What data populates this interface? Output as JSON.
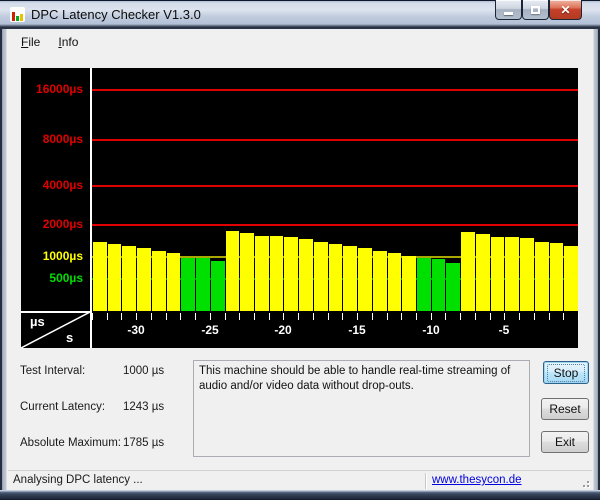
{
  "window": {
    "title": "DPC Latency Checker V1.3.0"
  },
  "titlebar_icons": {
    "app_icon": "bar-chart-icon",
    "minimize": "minimize-icon",
    "maximize": "maximize-icon",
    "close": "close-icon"
  },
  "menu": {
    "items": [
      {
        "label": "File"
      },
      {
        "label": "Info"
      }
    ]
  },
  "chart_data": {
    "type": "bar",
    "title": "DPC latency history (one bar per second, bar height = maximum latency in µs)",
    "ylabel": "µs",
    "xlabel": "s",
    "y_axis_unit_label": "µs",
    "x_axis_unit_label": "s",
    "scale_note": "pseudo-log scale: y_px = 77.9 * ln(1 + value/1000)",
    "ylim": [
      0,
      20000
    ],
    "grid": true,
    "gridlines": [
      {
        "value": 16000,
        "label": "16000µs",
        "label_color": "#e00000",
        "line_color": "#e00000"
      },
      {
        "value": 8000,
        "label": "8000µs",
        "label_color": "#e00000",
        "line_color": "#e00000"
      },
      {
        "value": 4000,
        "label": "4000µs",
        "label_color": "#e00000",
        "line_color": "#e00000"
      },
      {
        "value": 2000,
        "label": "2000µs",
        "label_color": "#e00000",
        "line_color": "#e00000"
      },
      {
        "value": 1000,
        "label": "1000µs",
        "label_color": "#ffff00",
        "line_color": "#a8a800"
      },
      {
        "value": 500,
        "label": "500µs",
        "label_color": "#00dd00",
        "line_color": "#00a000"
      }
    ],
    "x_tick_labels": [
      "-30",
      "-25",
      "-20",
      "-15",
      "-10",
      "-5"
    ],
    "x_tick_label_slots": [
      3,
      8,
      13,
      18,
      23,
      28
    ],
    "bar_count": 33,
    "values_us": [
      1434,
      1355,
      1313,
      1237,
      1160,
      1097,
      985,
      975,
      905,
      1785,
      1732,
      1630,
      1630,
      1597,
      1521,
      1416,
      1355,
      1313,
      1255,
      1160,
      1097,
      1032,
      982,
      957,
      862,
      1745,
      1685,
      1597,
      1597,
      1545,
      1434,
      1404,
      1313
    ],
    "bar_color_ok": "#00e000",
    "bar_color_warn": "#ffff00",
    "green_threshold_us": 1000,
    "plot_bg": "#000000"
  },
  "stats": {
    "rows": [
      {
        "label": "Test Interval:",
        "value": "1000 µs"
      },
      {
        "label": "Current Latency:",
        "value": "1243 µs"
      },
      {
        "label": "Absolute Maximum:",
        "value": "1785 µs"
      }
    ]
  },
  "info_panel": {
    "text": "This machine should be able to handle real-time streaming of audio and/or video data without drop-outs."
  },
  "buttons": [
    {
      "label": "Stop",
      "focused": true
    },
    {
      "label": "Reset",
      "focused": false
    },
    {
      "label": "Exit",
      "focused": false
    }
  ],
  "statusbar": {
    "left_text": "Analysing DPC latency ...",
    "link_text": "www.thesycon.de"
  },
  "colors": {
    "dialog_bg": "#f0f0f0",
    "chart_bg": "#000000",
    "red_grid": "#e00000",
    "yellow_bar": "#ffff00",
    "green_bar": "#00e000",
    "link_blue": "#0000e0",
    "close_button_red": "#c6402a"
  }
}
